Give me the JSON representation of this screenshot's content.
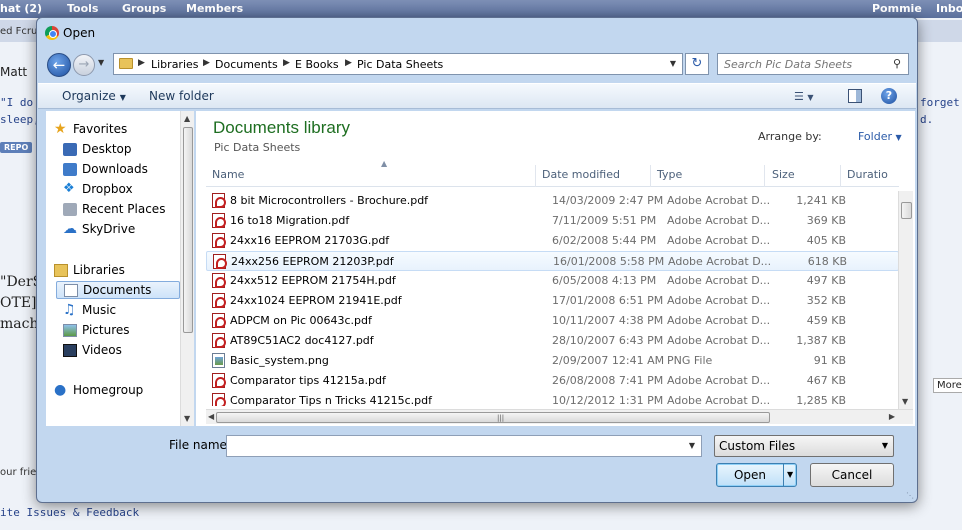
{
  "background": {
    "topbar": {
      "items": [
        "hat (2)",
        "Tools",
        "Groups",
        "Members"
      ],
      "user": "Pommie",
      "inbox": "Inbo"
    },
    "fragments": {
      "ted": "ed Fcru",
      "matt": "Matt",
      "quote1": "\"I do no",
      "quote2": "sleep, fi",
      "report": "REPO",
      "forget1": "forget fo",
      "forget2": "d.",
      "ders": "\"DerSt",
      "ote": "OTE]",
      "mach": "mach",
      "more": "More",
      "frien": "our frie",
      "feedback": "ite Issues & Feedback"
    }
  },
  "dialog": {
    "title": "Open",
    "breadcrumb": [
      "Libraries",
      "Documents",
      "E Books",
      "Pic Data Sheets"
    ],
    "search_placeholder": "Search Pic Data Sheets",
    "toolbar": {
      "organize": "Organize",
      "new_folder": "New folder"
    },
    "nav": {
      "favorites": "Favorites",
      "desktop": "Desktop",
      "downloads": "Downloads",
      "dropbox": "Dropbox",
      "recent_places": "Recent Places",
      "skydrive": "SkyDrive",
      "libraries": "Libraries",
      "documents": "Documents",
      "music": "Music",
      "pictures": "Pictures",
      "videos": "Videos",
      "homegroup": "Homegroup"
    },
    "library": {
      "title": "Documents library",
      "subtitle": "Pic Data Sheets",
      "arrange_by_label": "Arrange by:",
      "arrange_by_value": "Folder"
    },
    "columns": {
      "name": "Name",
      "date": "Date modified",
      "type": "Type",
      "size": "Size",
      "duration": "Duratio"
    },
    "files": [
      {
        "name": "8 bit Microcontrollers - Brochure.pdf",
        "date": "14/03/2009 2:47 PM",
        "type": "Adobe Acrobat D...",
        "size": "1,241 KB",
        "icon": "pdf-icon"
      },
      {
        "name": "16 to18 Migration.pdf",
        "date": "7/11/2009 5:51 PM",
        "type": "Adobe Acrobat D...",
        "size": "369 KB",
        "icon": "pdf-icon"
      },
      {
        "name": "24xx16 EEPROM 21703G.pdf",
        "date": "6/02/2008 5:44 PM",
        "type": "Adobe Acrobat D...",
        "size": "405 KB",
        "icon": "pdf-icon"
      },
      {
        "name": "24xx256 EEPROM 21203P.pdf",
        "date": "16/01/2008 5:58 PM",
        "type": "Adobe Acrobat D...",
        "size": "618 KB",
        "icon": "pdf-icon"
      },
      {
        "name": "24xx512 EEPROM 21754H.pdf",
        "date": "6/05/2008 4:13 PM",
        "type": "Adobe Acrobat D...",
        "size": "497 KB",
        "icon": "pdf-icon"
      },
      {
        "name": "24xx1024 EEPROM 21941E.pdf",
        "date": "17/01/2008 6:51 PM",
        "type": "Adobe Acrobat D...",
        "size": "352 KB",
        "icon": "pdf-icon"
      },
      {
        "name": "ADPCM on Pic 00643c.pdf",
        "date": "10/11/2007 4:38 PM",
        "type": "Adobe Acrobat D...",
        "size": "459 KB",
        "icon": "pdf-icon"
      },
      {
        "name": "AT89C51AC2 doc4127.pdf",
        "date": "28/10/2007 6:43 PM",
        "type": "Adobe Acrobat D...",
        "size": "1,387 KB",
        "icon": "pdf-icon"
      },
      {
        "name": "Basic_system.png",
        "date": "2/09/2007 12:41 AM",
        "type": "PNG File",
        "size": "91 KB",
        "icon": "png-icon"
      },
      {
        "name": "Comparator tips 41215a.pdf",
        "date": "26/08/2008 7:41 PM",
        "type": "Adobe Acrobat D...",
        "size": "467 KB",
        "icon": "pdf-icon"
      },
      {
        "name": "Comparator Tips n Tricks 41215c.pdf",
        "date": "10/12/2012 1:31 PM",
        "type": "Adobe Acrobat D...",
        "size": "1,285 KB",
        "icon": "pdf-icon"
      }
    ],
    "footer": {
      "filename_label": "File name:",
      "filename_value": "",
      "filter": "Custom Files",
      "open": "Open",
      "cancel": "Cancel"
    }
  }
}
